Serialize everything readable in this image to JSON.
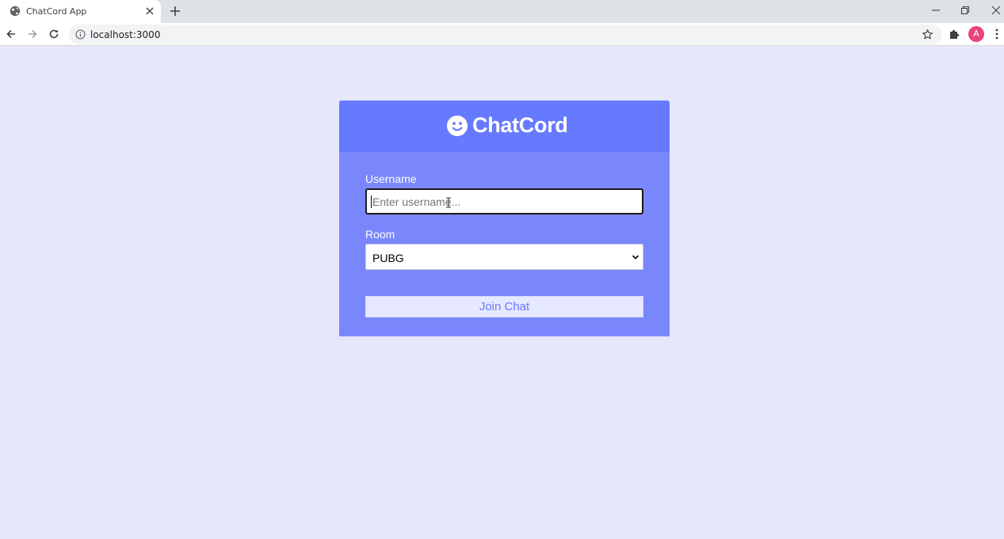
{
  "browser": {
    "tab_title": "ChatCord App",
    "url": "localhost:3000",
    "profile_initial": "A"
  },
  "app": {
    "logo_text": "ChatCord",
    "username_label": "Username",
    "username_placeholder": "Enter username...",
    "username_value": "",
    "room_label": "Room",
    "room_selected": "PUBG",
    "join_button_label": "Join Chat"
  },
  "colors": {
    "page_bg": "#e6e7fb",
    "header_bg": "#667aff",
    "card_bg": "#7a87fc",
    "button_text": "#667aff"
  }
}
